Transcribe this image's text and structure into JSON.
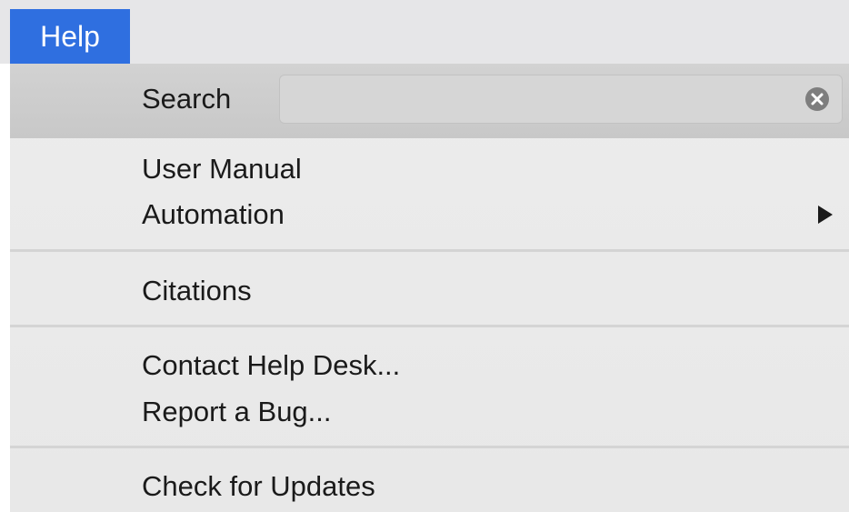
{
  "menubar": {
    "title": "Help"
  },
  "menu": {
    "search": {
      "label": "Search",
      "value": "",
      "placeholder": ""
    },
    "groups": [
      {
        "items": [
          {
            "label": "User Manual"
          },
          {
            "label": "Automation",
            "submenu": true
          }
        ]
      },
      {
        "items": [
          {
            "label": "Citations"
          }
        ]
      },
      {
        "items": [
          {
            "label": "Contact Help Desk..."
          },
          {
            "label": "Report a Bug..."
          }
        ]
      },
      {
        "items": [
          {
            "label": "Check for Updates"
          }
        ]
      }
    ]
  },
  "icons": {
    "clear": "clear-circle-x-icon",
    "submenu": "submenu-arrow-icon"
  },
  "colors": {
    "menubar_active": "#2f6fe0",
    "menu_bg": "#ececec",
    "search_row_bg": "#cccccc",
    "separator": "#d4d4d4"
  }
}
